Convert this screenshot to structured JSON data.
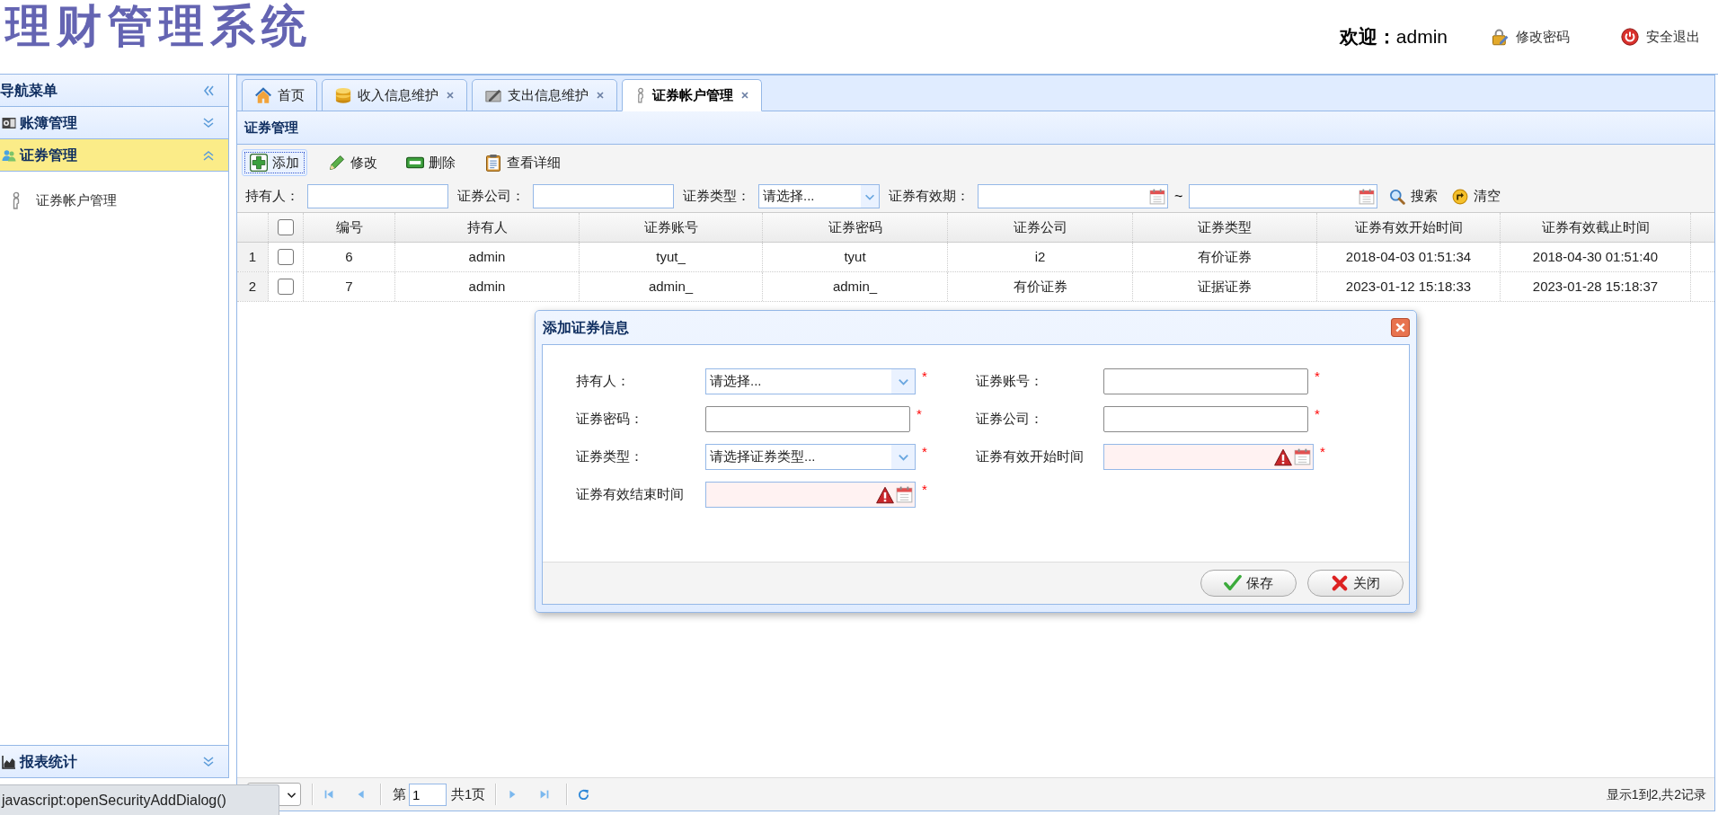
{
  "header": {
    "logo": "理财管理系统",
    "welcome_label": "欢迎：",
    "username": "admin",
    "links": [
      {
        "label": "修改密码"
      },
      {
        "label": "安全退出"
      }
    ]
  },
  "sidebar": {
    "title": "导航菜单",
    "sections": [
      {
        "label": "账簿管理",
        "expanded": false
      },
      {
        "label": "证券管理",
        "expanded": true,
        "items": [
          {
            "label": "证券帐户管理",
            "selected": false
          }
        ]
      },
      {
        "label": "报表统计",
        "expanded": false
      }
    ]
  },
  "tabs": [
    {
      "label": "首页",
      "closable": false,
      "selected": false
    },
    {
      "label": "收入信息维护",
      "closable": true,
      "selected": false
    },
    {
      "label": "支出信息维护",
      "closable": true,
      "selected": false
    },
    {
      "label": "证券帐户管理",
      "closable": true,
      "selected": true
    }
  ],
  "panel": {
    "title": "证券管理",
    "toolbar": [
      {
        "label": "添加",
        "focused": true
      },
      {
        "label": "修改",
        "focused": false
      },
      {
        "label": "删除",
        "focused": false
      },
      {
        "label": "查看详细",
        "focused": false
      }
    ],
    "filters": [
      {
        "kind": "text",
        "label": "持有人："
      },
      {
        "kind": "text",
        "label": "证券公司："
      },
      {
        "kind": "select",
        "label": "证券类型：",
        "value": "请选择..."
      },
      {
        "kind": "daterange",
        "label": "证券有效期：",
        "separator": "~"
      }
    ],
    "filter_buttons": [
      {
        "label": "搜索"
      },
      {
        "label": "清空"
      }
    ],
    "table": {
      "header_checked": false,
      "columns": [
        "编号",
        "持有人",
        "证券账号",
        "证券密码",
        "证券公司",
        "证券类型",
        "证券有效开始时间",
        "证券有效截止时间"
      ],
      "rows": [
        {
          "number": "1",
          "checked": false,
          "cells": [
            "6",
            "admin",
            "tyut_",
            "tyut",
            "i2",
            "有价证券",
            "2018-04-03 01:51:34",
            "2018-04-30 01:51:40"
          ]
        },
        {
          "number": "2",
          "checked": false,
          "cells": [
            "7",
            "admin",
            "admin_",
            "admin_",
            "有价证券",
            "证据证券",
            "2023-01-12 15:18:33",
            "2023-01-28 15:18:37"
          ]
        }
      ]
    },
    "pager": {
      "page_prefix": "第",
      "page": "1",
      "page_suffix": "共1页",
      "summary": "显示1到2,共2记录"
    }
  },
  "dialog": {
    "title": "添加证券信息",
    "fields": [
      {
        "kind": "select",
        "label": "持有人：",
        "value": "请选择...",
        "required_mark": "*"
      },
      {
        "kind": "text",
        "label": "证券账号：",
        "required_mark": "*"
      },
      {
        "kind": "text",
        "label": "证券密码：",
        "required_mark": "*"
      },
      {
        "kind": "text",
        "label": "证券公司：",
        "required_mark": "*"
      },
      {
        "kind": "select",
        "label": "证券类型：",
        "value": "请选择证券类型...",
        "required_mark": "*"
      },
      {
        "kind": "date",
        "label": "证券有效开始时间",
        "invalid": true,
        "required_mark": "*"
      },
      {
        "kind": "date",
        "label": "证券有效结束时间",
        "invalid": true,
        "required_mark": "*"
      }
    ],
    "buttons": [
      {
        "label": "保存"
      },
      {
        "label": "关闭"
      }
    ]
  },
  "status_bar": {
    "text": "javascript:openSecurityAddDialog()"
  }
}
